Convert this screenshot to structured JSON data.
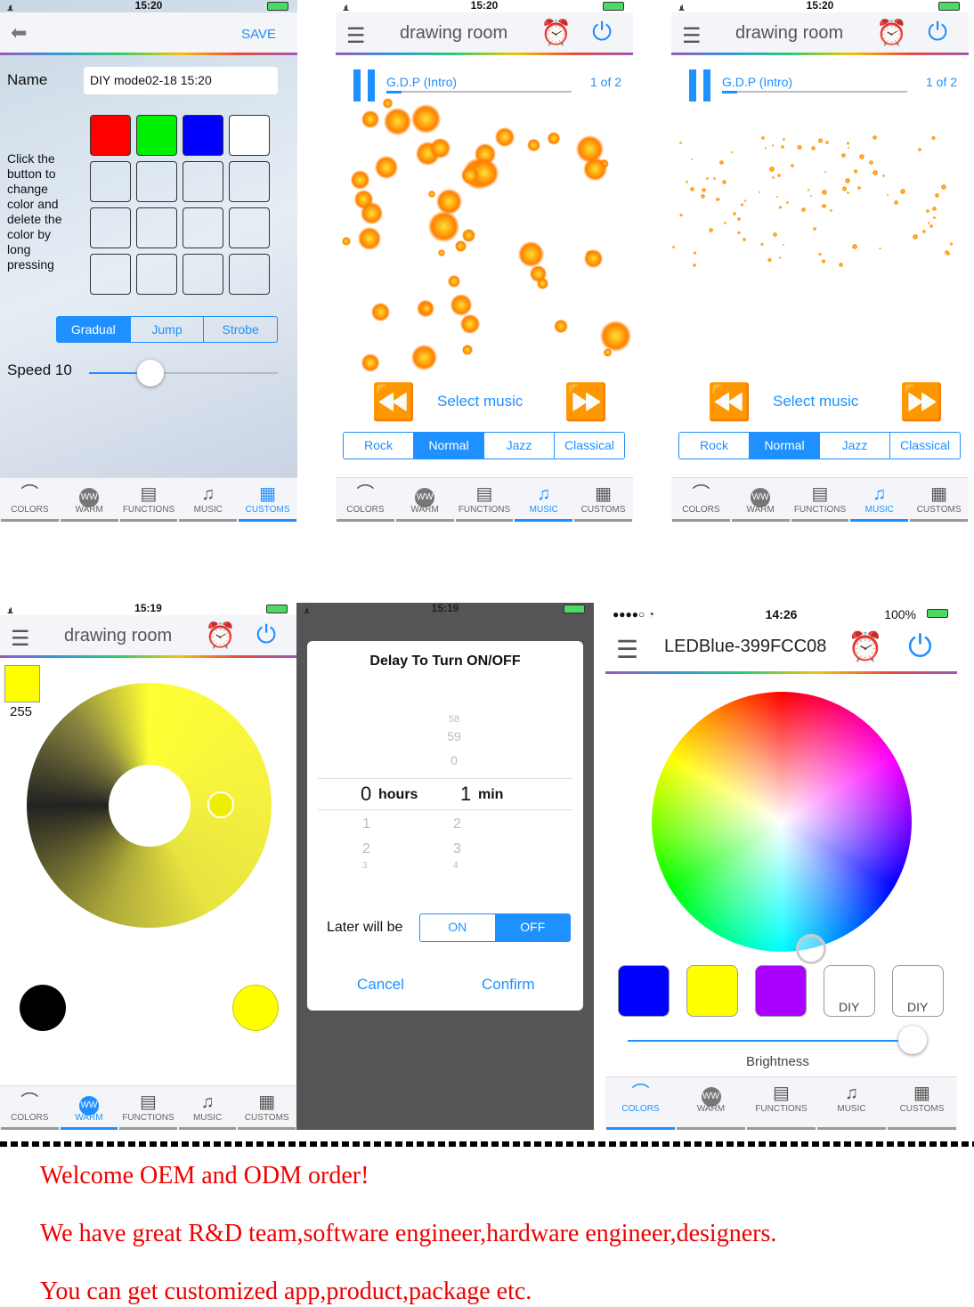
{
  "status": {
    "time_a": "15:20",
    "time_b": "15:19",
    "time_c": "14:26",
    "battery_c": "100%"
  },
  "tabs": [
    "COLORS",
    "WARM",
    "FUNCTIONS",
    "MUSIC",
    "CUSTOMS"
  ],
  "tab_icons": [
    "rainbow-icon",
    "ww-icon",
    "functions-icon",
    "music-icon",
    "customs-icon"
  ],
  "custom": {
    "save": "SAVE",
    "name_label": "Name",
    "name_value": "DIY mode02-18 15:20",
    "hint": "Click the button to change color and delete the color by long pressing",
    "colors": [
      "#ff0000",
      "#00ee00",
      "#0000ff",
      "#ffffff"
    ],
    "modes": [
      "Gradual",
      "Jump",
      "Strobe"
    ],
    "active_mode": "Gradual",
    "speed_label": "Speed 10",
    "speed": 10
  },
  "music": {
    "title": "drawing room",
    "track": "G.D.P (Intro)",
    "count": "1 of 2",
    "select": "Select music",
    "genres": [
      "Rock",
      "Normal",
      "Jazz",
      "Classical"
    ],
    "active_genre": "Normal"
  },
  "warm": {
    "title": "drawing room",
    "value": "255",
    "color": "#ffff00"
  },
  "delay": {
    "title": "Delay To Turn ON/OFF",
    "min_above": [
      "58",
      "59",
      "0"
    ],
    "hours": "0",
    "hours_unit": "hours",
    "mins": "1",
    "mins_unit": "min",
    "hours_below": [
      "1",
      "2",
      "3"
    ],
    "mins_below": [
      "2",
      "3",
      "4"
    ],
    "later": "Later will be",
    "on": "ON",
    "off": "OFF",
    "cancel": "Cancel",
    "confirm": "Confirm"
  },
  "colors": {
    "title": "LEDBlue-399FCC08",
    "presets": [
      "#0000ff",
      "#ffff00",
      "#aa00ff"
    ],
    "diy": "DIY",
    "brightness": "Brightness"
  },
  "promo": [
    "Welcome OEM and ODM order!",
    "We have great R&D team,software engineer,hardware engineer,designers.",
    "You can get customized app,product,package etc."
  ]
}
